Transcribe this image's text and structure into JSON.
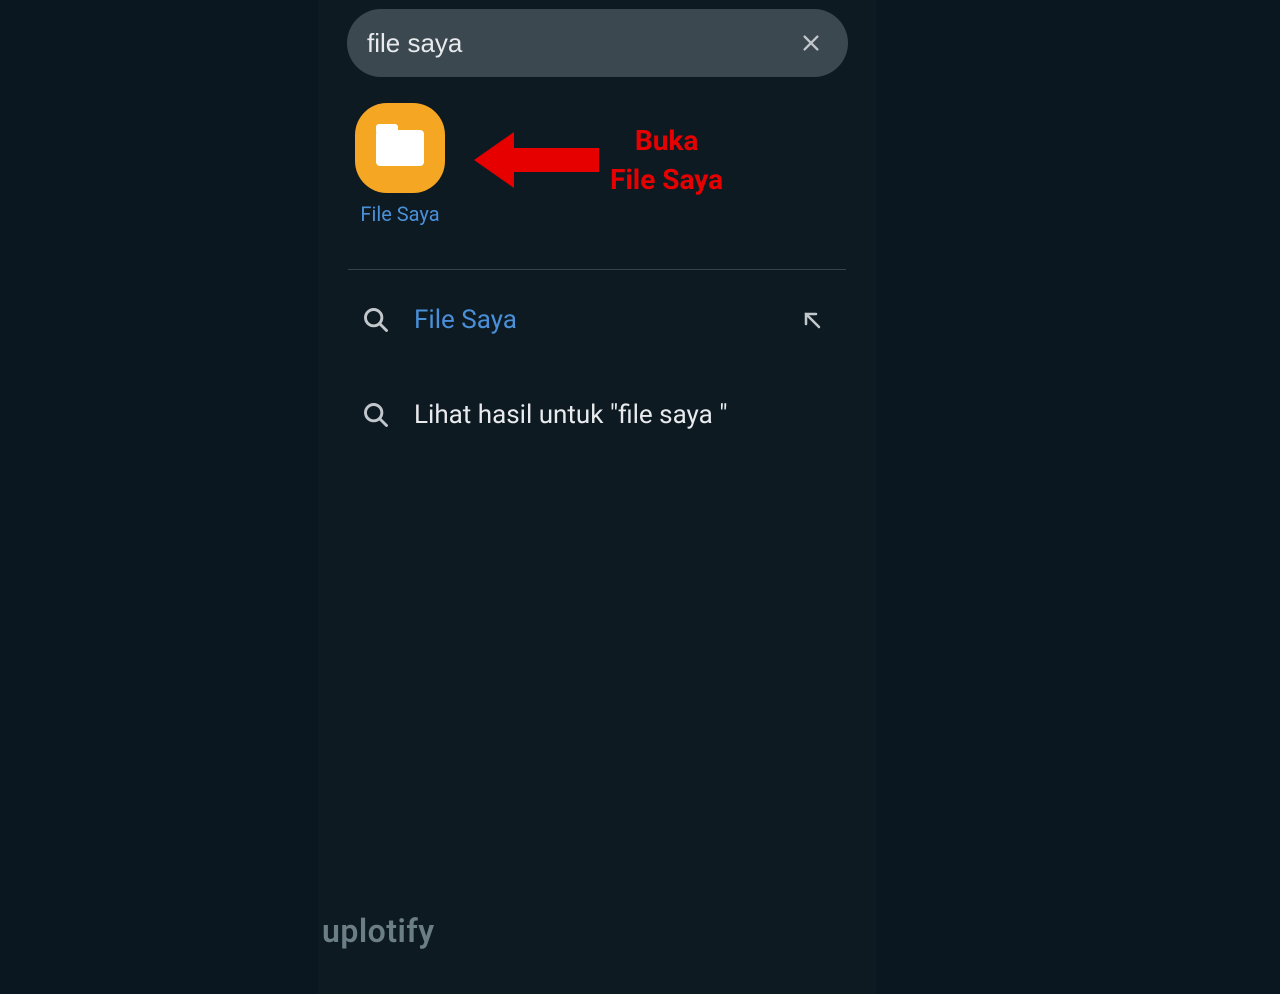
{
  "search": {
    "value": "file saya"
  },
  "app_result": {
    "label": "File Saya"
  },
  "annotation": {
    "line1": "Buka",
    "line2": "File Saya"
  },
  "suggestions": [
    {
      "text": "File Saya",
      "highlighted": true,
      "has_insert": true
    },
    {
      "text": "Lihat hasil untuk \"file saya \"",
      "highlighted": false,
      "has_insert": false
    }
  ],
  "watermark": "uplotify",
  "colors": {
    "background": "#0a1620",
    "phone_bg": "#0d1a22",
    "search_bg": "#3b4850",
    "accent_blue": "#4a90d9",
    "accent_orange": "#f5a623",
    "annotation_red": "#e60000",
    "text_light": "#e8eaed",
    "text_muted": "#c2c7cb"
  }
}
